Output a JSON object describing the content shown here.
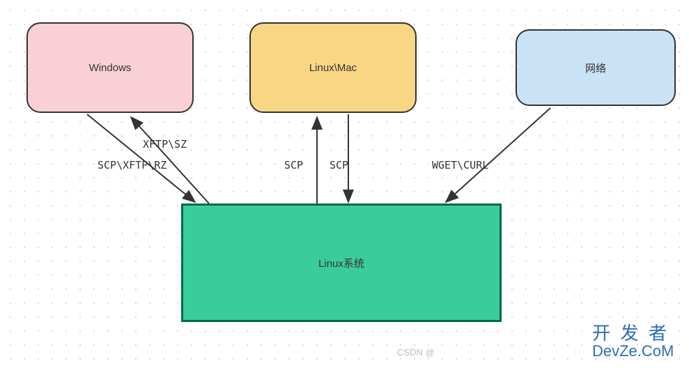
{
  "boxes": {
    "windows": "Windows",
    "linuxmac": "Linux\\Mac",
    "network": "网络",
    "linuxsys": "Linux系统"
  },
  "edges": {
    "xftp_sz": "XFTP\\SZ",
    "scp_xftp_rz": "SCP\\XFTP\\RZ",
    "scp_up": "SCP",
    "scp_down": "SCP",
    "wget_curl": "WGET\\CURL"
  },
  "watermarks": {
    "csdn": "CSDN @",
    "devze_cn": "开 发 者",
    "devze_en": "DevZe.CoM"
  },
  "colors": {
    "windows_bg": "#f9d0d6",
    "linuxmac_bg": "#f8d683",
    "network_bg": "#cae2f5",
    "linuxsys_bg": "#3acc9a",
    "linuxsys_border": "#006b45"
  }
}
